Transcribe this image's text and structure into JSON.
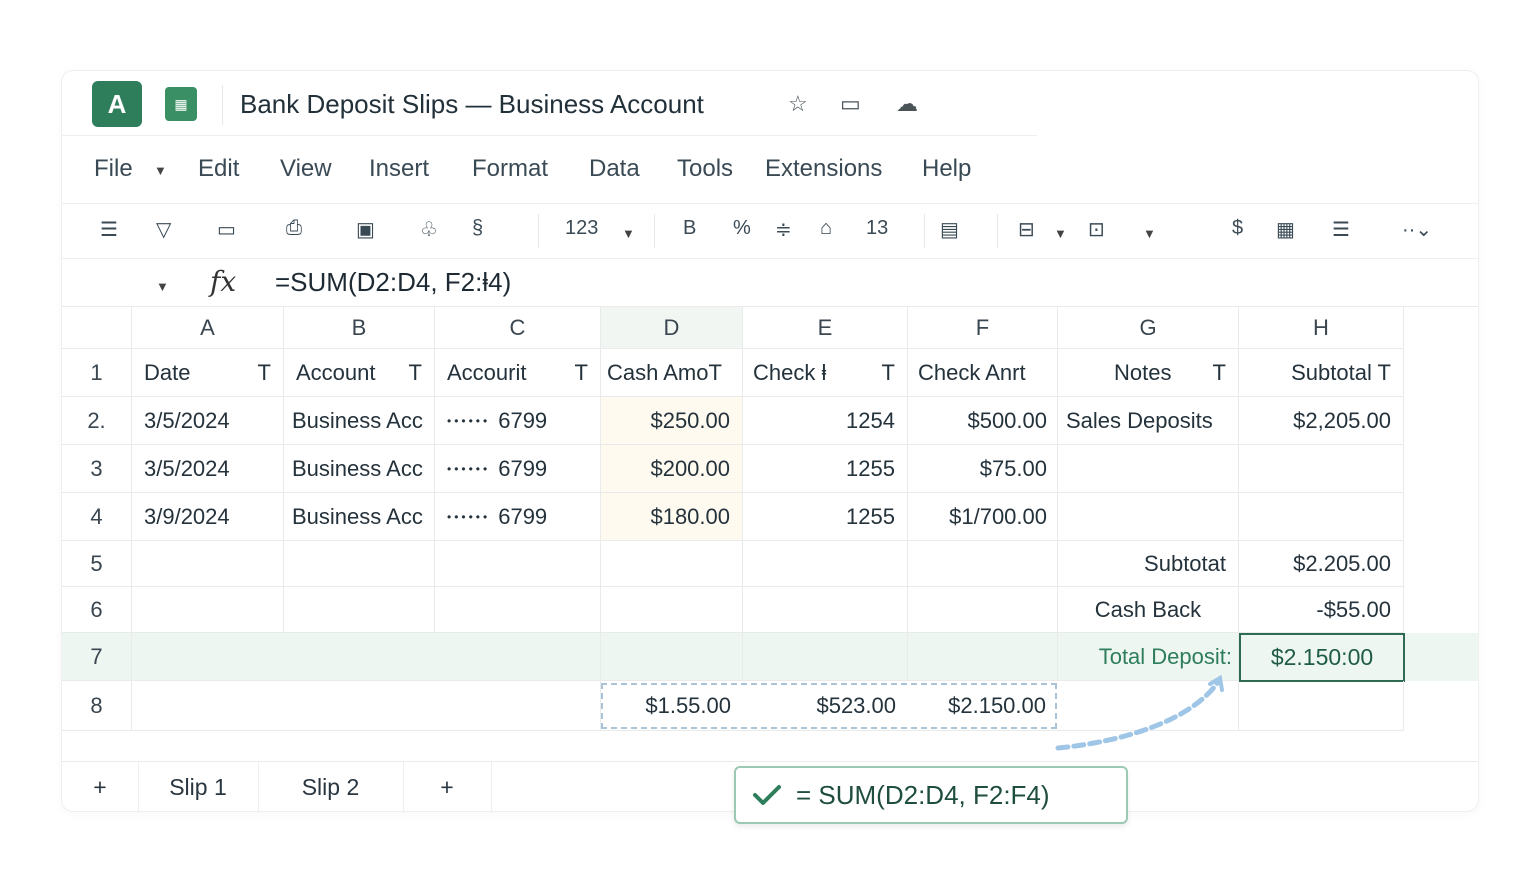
{
  "app": {
    "logo_letter": "A",
    "file_icon": "sheet-file-icon",
    "title": "Bank Deposit Slips — Business Account",
    "title_icons": [
      "star-icon",
      "drive-icon",
      "cloud-icon"
    ]
  },
  "menu": {
    "file": "File",
    "edit": "Edit",
    "view": "View",
    "insert": "Insert",
    "format": "Format",
    "data": "Data",
    "tools": "Tools",
    "extensions": "Extensions",
    "help": "Help"
  },
  "toolbar": {
    "number_format": "123",
    "bold": "B",
    "percent": "%",
    "font_size": "13",
    "currency": "$"
  },
  "formula_bar": {
    "fx": "fx",
    "formula": "=SUM(D2:D4, F2:ⱡ4)"
  },
  "columns": [
    "A",
    "B",
    "C",
    "D",
    "E",
    "F",
    "G",
    "H"
  ],
  "headers": {
    "date": "Date",
    "account": "Account",
    "account2": "Accourit",
    "cash": "Cash AmoT",
    "check_no": "Check ⱡ",
    "check_amt": "Check Anrt",
    "notes": "Notes",
    "subtotal": "Subtotal T",
    "filter": "T"
  },
  "rows": [
    {
      "num": "2.",
      "date": "3/5/2024",
      "account": "Business Acc",
      "acct_mask": "••••••",
      "acct_last": "6799",
      "cash": "$250.00",
      "check_no": "1254",
      "check_amt": "$500.00",
      "notes": "Sales Deposits",
      "subtotal": "$2,205.00"
    },
    {
      "num": "3",
      "date": "3/5/2024",
      "account": "Business Acc",
      "acct_mask": "••••••",
      "acct_last": "6799",
      "cash": "$200.00",
      "check_no": "1255",
      "check_amt": "$75.00",
      "notes": "",
      "subtotal": ""
    },
    {
      "num": "4",
      "date": "3/9/2024",
      "account": "Business Acc",
      "acct_mask": "••••••",
      "acct_last": "6799",
      "cash": "$180.00",
      "check_no": "1255",
      "check_amt": "$1/700.00",
      "notes": "",
      "subtotal": ""
    }
  ],
  "row_numbers": {
    "r1": "1",
    "r5": "5",
    "r6": "6",
    "r7": "7",
    "r8": "8"
  },
  "summary": {
    "subtotal_label": "Subtotat",
    "subtotal_value": "$2.205.00",
    "cashback_label": "Cash Back",
    "cashback_value": "-$55.00",
    "total_label": "Total Deposit:",
    "total_value": "$2.150:00"
  },
  "row8": {
    "d": "$1.55.00",
    "e": "$523.00",
    "f": "$2.150.00"
  },
  "sheets": {
    "slip1": "Slip 1",
    "slip2": "Slip 2"
  },
  "suggestion": {
    "text": "= SUM(D2:D4, F2:F4)"
  },
  "colors": {
    "accent": "#2e7d5b",
    "total_row": "#eef6f2",
    "cash_col": "#fffaf0"
  }
}
